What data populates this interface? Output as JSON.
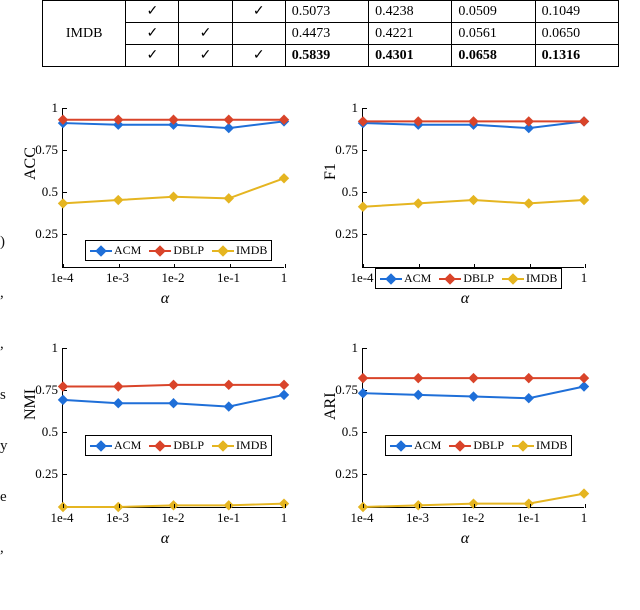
{
  "table": {
    "rowhead": "IMDB",
    "check": "✓",
    "rows": [
      {
        "c1": true,
        "c2": false,
        "c3": true,
        "v": [
          "0.5073",
          "0.4238",
          "0.0509",
          "0.1049"
        ],
        "bold": false
      },
      {
        "c1": true,
        "c2": true,
        "c3": false,
        "v": [
          "0.4473",
          "0.4221",
          "0.0561",
          "0.0650"
        ],
        "bold": false
      },
      {
        "c1": true,
        "c2": true,
        "c3": true,
        "v": [
          "0.5839",
          "0.4301",
          "0.0658",
          "0.1316"
        ],
        "bold": true
      }
    ]
  },
  "axis": {
    "yticks": [
      0.25,
      0.5,
      0.75,
      1
    ],
    "ymin": 0.05,
    "ymax": 1.0,
    "xticks": [
      "1e-4",
      "1e-3",
      "1e-2",
      "1e-1",
      "1"
    ],
    "xlabel": "α"
  },
  "series_names": {
    "acm": "ACM",
    "dblp": "DBLP",
    "imdb": "IMDB"
  },
  "colors": {
    "acm": "#1f6fd8",
    "dblp": "#d9442a",
    "imdb": "#e5b521"
  },
  "chart_data": [
    {
      "type": "line",
      "title": "",
      "xlabel": "α",
      "ylabel": "ACC",
      "ylim": [
        0.05,
        1.0
      ],
      "x": [
        "1e-4",
        "1e-3",
        "1e-2",
        "1e-1",
        "1"
      ],
      "series": [
        {
          "name": "ACM",
          "values": [
            0.91,
            0.9,
            0.9,
            0.88,
            0.92
          ]
        },
        {
          "name": "DBLP",
          "values": [
            0.93,
            0.93,
            0.93,
            0.93,
            0.93
          ]
        },
        {
          "name": "IMDB",
          "values": [
            0.43,
            0.45,
            0.47,
            0.46,
            0.58
          ]
        }
      ],
      "legend_pos": "inside-bottom"
    },
    {
      "type": "line",
      "title": "",
      "xlabel": "α",
      "ylabel": "F1",
      "ylim": [
        0.05,
        1.0
      ],
      "x": [
        "1e-4",
        "1e-3",
        "1e-2",
        "1e-1",
        "1"
      ],
      "series": [
        {
          "name": "ACM",
          "values": [
            0.91,
            0.9,
            0.9,
            0.88,
            0.92
          ]
        },
        {
          "name": "DBLP",
          "values": [
            0.92,
            0.92,
            0.92,
            0.92,
            0.92
          ]
        },
        {
          "name": "IMDB",
          "values": [
            0.41,
            0.43,
            0.45,
            0.43,
            0.45
          ]
        }
      ],
      "legend_pos": "below"
    },
    {
      "type": "line",
      "title": "",
      "xlabel": "α",
      "ylabel": "NMI",
      "ylim": [
        0.05,
        1.0
      ],
      "x": [
        "1e-4",
        "1e-3",
        "1e-2",
        "1e-1",
        "1"
      ],
      "series": [
        {
          "name": "ACM",
          "values": [
            0.69,
            0.67,
            0.67,
            0.65,
            0.72
          ]
        },
        {
          "name": "DBLP",
          "values": [
            0.77,
            0.77,
            0.78,
            0.78,
            0.78
          ]
        },
        {
          "name": "IMDB",
          "values": [
            0.05,
            0.05,
            0.06,
            0.06,
            0.07
          ]
        }
      ],
      "legend_pos": "inside-mid"
    },
    {
      "type": "line",
      "title": "",
      "xlabel": "α",
      "ylabel": "ARI",
      "ylim": [
        0.05,
        1.0
      ],
      "x": [
        "1e-4",
        "1e-3",
        "1e-2",
        "1e-1",
        "1"
      ],
      "series": [
        {
          "name": "ACM",
          "values": [
            0.73,
            0.72,
            0.71,
            0.7,
            0.77
          ]
        },
        {
          "name": "DBLP",
          "values": [
            0.82,
            0.82,
            0.82,
            0.82,
            0.82
          ]
        },
        {
          "name": "IMDB",
          "values": [
            0.05,
            0.06,
            0.07,
            0.07,
            0.13
          ]
        }
      ],
      "legend_pos": "inside-mid"
    }
  ],
  "left_fragments": [
    ")",
    ",",
    "",
    ",",
    "s",
    "y",
    "e",
    ","
  ]
}
